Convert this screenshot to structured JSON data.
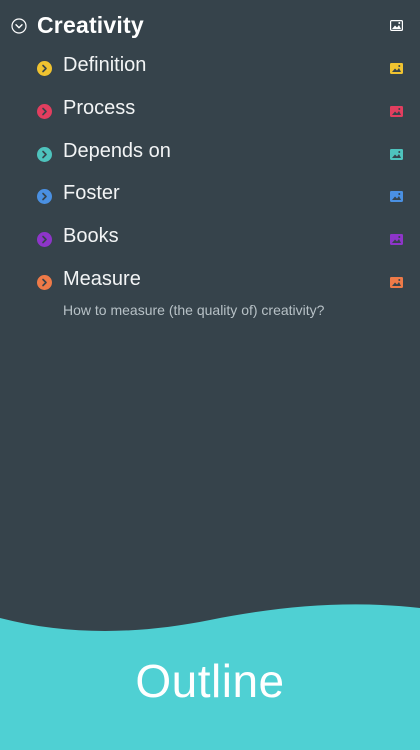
{
  "outline": {
    "root": {
      "title": "Creativity",
      "icon": "chevron-down-circle-icon",
      "image_icon": "image-icon"
    },
    "items": [
      {
        "label": "Definition",
        "color": "#f0c330"
      },
      {
        "label": "Process",
        "color": "#e23e5f"
      },
      {
        "label": "Depends on",
        "color": "#4ec3bd"
      },
      {
        "label": "Foster",
        "color": "#4a90e2"
      },
      {
        "label": "Books",
        "color": "#8e35c9"
      },
      {
        "label": "Measure",
        "color": "#ee7a48"
      }
    ],
    "note": "How to measure (the quality of) creativity?"
  },
  "footer": {
    "title": "Outline",
    "color": "#4fd0d3"
  }
}
